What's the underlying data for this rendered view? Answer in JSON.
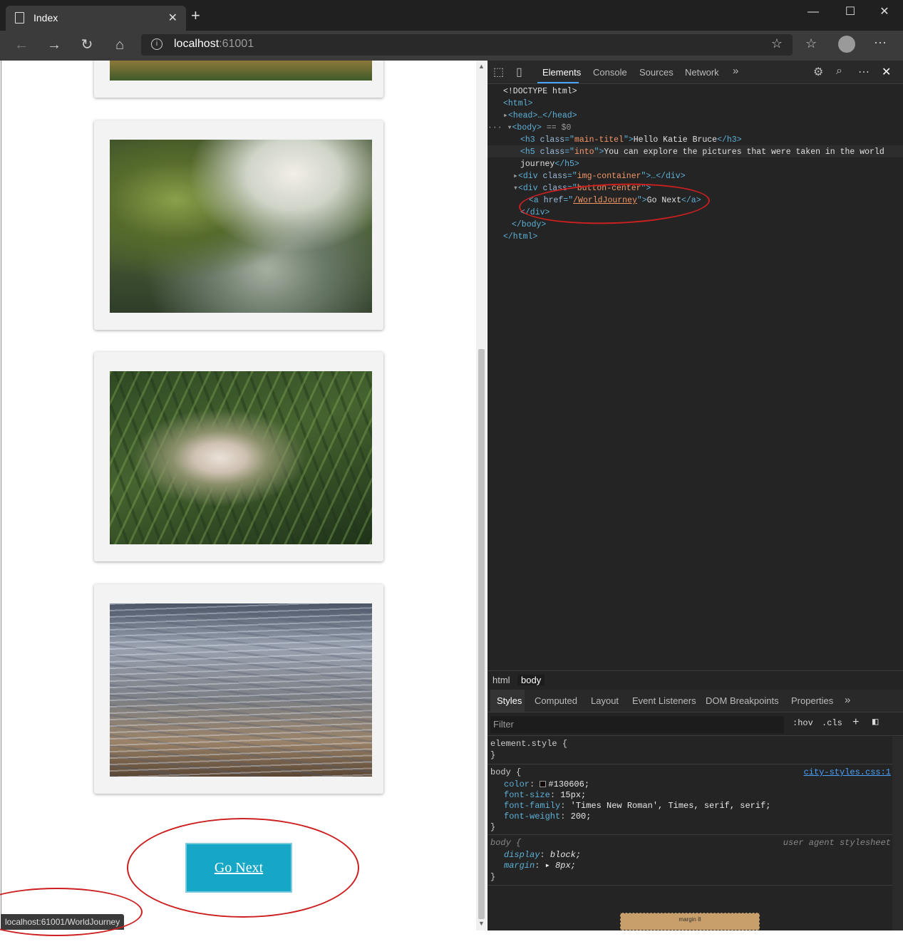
{
  "browser": {
    "tab_title": "Index",
    "tab_close": "✕",
    "new_tab": "+",
    "min": "—",
    "max": "☐",
    "close": "✕",
    "url_host": "localhost",
    "url_port": ":61001",
    "status_url": "localhost:61001/WorldJourney"
  },
  "page": {
    "button_label": "Go Next"
  },
  "devtools": {
    "tabs": [
      "Elements",
      "Console",
      "Sources",
      "Network"
    ],
    "more": "»",
    "dom": {
      "doctype": "<!DOCTYPE html>",
      "html_open": "<html>",
      "head": "<head>…</head>",
      "body_open": "<body>",
      "body_marker": "== $0",
      "h3_tag": "<h3 class=\"main-titel\">",
      "h3_text": "Hello Katie Bruce",
      "h3_close": "</h3>",
      "h5_tag": "<h5 class=\"into\">",
      "h5_text_1": "You can explore the pictures that were taken in the world",
      "h5_text_2": "journey",
      "h5_close": "</h5>",
      "img_container": "<div class=\"img-container\">…</div>",
      "button_center": "<div class=\"button-center\">",
      "a_open": "<a href=\"",
      "a_href": "/WorldJourney",
      "a_mid": "\">",
      "a_text": "Go Next",
      "a_close": "</a>",
      "div_close": "</div>",
      "body_close": "</body>",
      "html_close": "</html>"
    },
    "breadcrumbs": [
      "html",
      "body"
    ],
    "style_tabs": [
      "Styles",
      "Computed",
      "Layout",
      "Event Listeners",
      "DOM Breakpoints",
      "Properties"
    ],
    "filter_placeholder": "Filter",
    "filter_buttons": [
      ":hov",
      ".cls",
      "+"
    ],
    "rules": {
      "element_style": "element.style {",
      "close_brace": "}",
      "body_sel": "body {",
      "body_source": "city-styles.css:1",
      "color_name": "color",
      "color_value": "#130606;",
      "fs_name": "font-size",
      "fs_value": "15px;",
      "ff_name": "font-family",
      "ff_value": "'Times New Roman', Times, serif, serif;",
      "fw_name": "font-weight",
      "fw_value": "200;",
      "ua_sel": "body {",
      "ua_source": "user agent stylesheet",
      "display_name": "display",
      "display_value": "block;",
      "margin_name": "margin",
      "margin_value": "▸ 8px;"
    },
    "box_model": {
      "label": "margin",
      "value": "8"
    }
  }
}
